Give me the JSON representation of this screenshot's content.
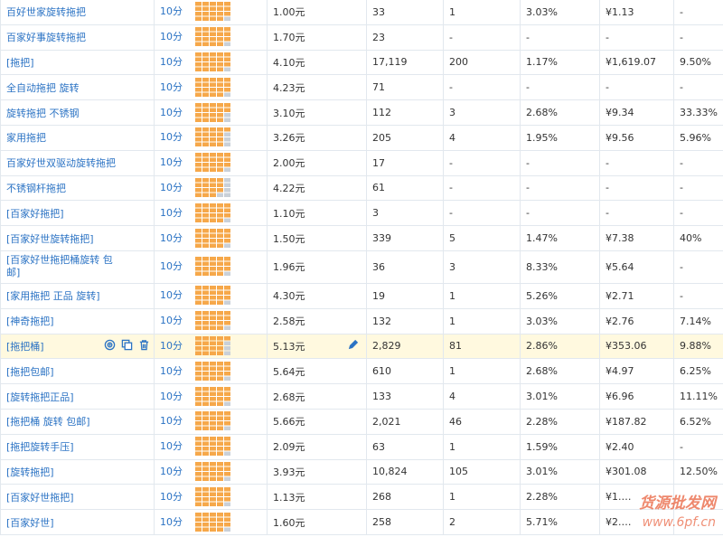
{
  "rows": [
    {
      "kw": "百好世家旋转拖把",
      "score": "10分",
      "level": 0.95,
      "price": "1.00元",
      "pv": "33",
      "clicks": "1",
      "ctr": "3.03%",
      "cost": "¥1.13",
      "roi": "-"
    },
    {
      "kw": "百家好事旋转拖把",
      "score": "10分",
      "level": 0.95,
      "price": "1.70元",
      "pv": "23",
      "clicks": "-",
      "ctr": "-",
      "cost": "-",
      "roi": "-"
    },
    {
      "kw": "[拖把]",
      "score": "10分",
      "level": 0.95,
      "price": "4.10元",
      "pv": "17,119",
      "clicks": "200",
      "ctr": "1.17%",
      "cost": "¥1,619.07",
      "roi": "9.50%"
    },
    {
      "kw": "全自动拖把 旋转",
      "score": "10分",
      "level": 0.95,
      "price": "4.23元",
      "pv": "71",
      "clicks": "-",
      "ctr": "-",
      "cost": "-",
      "roi": "-"
    },
    {
      "kw": "旋转拖把 不锈钢",
      "score": "10分",
      "level": 0.9,
      "price": "3.10元",
      "pv": "112",
      "clicks": "3",
      "ctr": "2.68%",
      "cost": "¥9.34",
      "roi": "33.33%"
    },
    {
      "kw": "家用拖把",
      "score": "10分",
      "level": 0.85,
      "price": "3.26元",
      "pv": "205",
      "clicks": "4",
      "ctr": "1.95%",
      "cost": "¥9.56",
      "roi": "5.96%"
    },
    {
      "kw": "百家好世双驱动旋转拖把",
      "score": "10分",
      "level": 0.95,
      "price": "2.00元",
      "pv": "17",
      "clicks": "-",
      "ctr": "-",
      "cost": "-",
      "roi": "-"
    },
    {
      "kw": "不锈钢杆拖把",
      "score": "10分",
      "level": 0.75,
      "price": "4.22元",
      "pv": "61",
      "clicks": "-",
      "ctr": "-",
      "cost": "-",
      "roi": "-"
    },
    {
      "kw": "[百家好拖把]",
      "score": "10分",
      "level": 0.95,
      "price": "1.10元",
      "pv": "3",
      "clicks": "-",
      "ctr": "-",
      "cost": "-",
      "roi": "-"
    },
    {
      "kw": "[百家好世旋转拖把]",
      "score": "10分",
      "level": 0.95,
      "price": "1.50元",
      "pv": "339",
      "clicks": "5",
      "ctr": "1.47%",
      "cost": "¥7.38",
      "roi": "40%"
    },
    {
      "kw": "[百家好世拖把桶旋转 包邮]",
      "score": "10分",
      "level": 0.95,
      "price": "1.96元",
      "pv": "36",
      "clicks": "3",
      "ctr": "8.33%",
      "cost": "¥5.64",
      "roi": "-",
      "tall": true
    },
    {
      "kw": "[家用拖把 正品 旋转]",
      "score": "10分",
      "level": 0.95,
      "price": "4.30元",
      "pv": "19",
      "clicks": "1",
      "ctr": "5.26%",
      "cost": "¥2.71",
      "roi": "-"
    },
    {
      "kw": "[神奇拖把]",
      "score": "10分",
      "level": 0.95,
      "price": "2.58元",
      "pv": "132",
      "clicks": "1",
      "ctr": "3.03%",
      "cost": "¥2.76",
      "roi": "7.14%"
    },
    {
      "kw": "[拖把桶]",
      "score": "10分",
      "level": 0.85,
      "price": "5.13元",
      "pv": "2,829",
      "clicks": "81",
      "ctr": "2.86%",
      "cost": "¥353.06",
      "roi": "9.88%",
      "highlight": true
    },
    {
      "kw": "[拖把包邮]",
      "score": "10分",
      "level": 0.95,
      "price": "5.64元",
      "pv": "610",
      "clicks": "1",
      "ctr": "2.68%",
      "cost": "¥4.97",
      "roi": "6.25%"
    },
    {
      "kw": "[旋转拖把正品]",
      "score": "10分",
      "level": 0.95,
      "price": "2.68元",
      "pv": "133",
      "clicks": "4",
      "ctr": "3.01%",
      "cost": "¥6.96",
      "roi": "11.11%"
    },
    {
      "kw": "[拖把桶 旋转 包邮]",
      "score": "10分",
      "level": 0.95,
      "price": "5.66元",
      "pv": "2,021",
      "clicks": "46",
      "ctr": "2.28%",
      "cost": "¥187.82",
      "roi": "6.52%"
    },
    {
      "kw": "[拖把旋转手压]",
      "score": "10分",
      "level": 0.95,
      "price": "2.09元",
      "pv": "63",
      "clicks": "1",
      "ctr": "1.59%",
      "cost": "¥2.40",
      "roi": "-"
    },
    {
      "kw": "[旋转拖把]",
      "score": "10分",
      "level": 0.95,
      "price": "3.93元",
      "pv": "10,824",
      "clicks": "105",
      "ctr": "3.01%",
      "cost": "¥301.08",
      "roi": "12.50%"
    },
    {
      "kw": "[百家好世拖把]",
      "score": "10分",
      "level": 0.95,
      "price": "1.13元",
      "pv": "268",
      "clicks": "1",
      "ctr": "2.28%",
      "cost": "¥1.…",
      "roi": ""
    },
    {
      "kw": "[百家好世]",
      "score": "10分",
      "level": 0.95,
      "price": "1.60元",
      "pv": "258",
      "clicks": "2",
      "ctr": "5.71%",
      "cost": "¥2.…",
      "roi": ""
    }
  ],
  "watermark": {
    "line1": "货源批发网",
    "line2": "www.6pf.cn"
  },
  "colors": {
    "bar": "#f6a84a",
    "bar_empty": "#c9d0d8",
    "link": "#2b73c4",
    "highlight": "#fff9df"
  },
  "icons": {
    "target": "target-icon",
    "copy": "copy-icon",
    "delete": "trash-icon",
    "edit": "pencil-icon"
  }
}
